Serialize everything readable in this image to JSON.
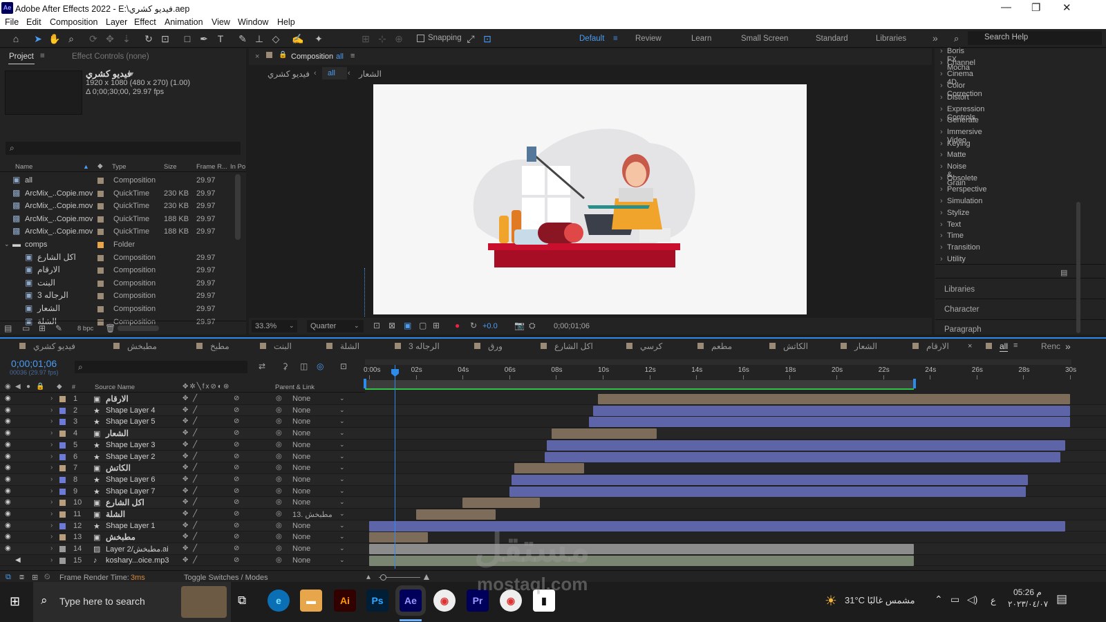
{
  "window": {
    "title": "Adobe After Effects 2022 - E:\\فيديو كشري.aep",
    "app_badge": "Ae"
  },
  "menu": [
    "File",
    "Edit",
    "Composition",
    "Layer",
    "Effect",
    "Animation",
    "View",
    "Window",
    "Help"
  ],
  "toolbar": {
    "snapping_label": "Snapping",
    "workspaces": [
      "Default",
      "Review",
      "Learn",
      "Small Screen",
      "Standard",
      "Libraries"
    ],
    "active_workspace": "Default",
    "search_placeholder": "Search Help"
  },
  "project": {
    "tab_project": "Project",
    "tab_effect_controls": "Effect Controls (none)",
    "comp_name": "فيديو كشري",
    "comp_dims": "1920 x 1080  (480 x 270) (1.00)",
    "comp_duration": "Δ 0;00;30;00, 29.97 fps",
    "columns": [
      "Name",
      "Type",
      "Size",
      "Frame R...",
      "In Po"
    ],
    "items": [
      {
        "name": "all",
        "type": "Composition",
        "size": "",
        "fps": "29.97",
        "color": "#9b8a76",
        "icon": "comp-icon"
      },
      {
        "name": "ArcMix_..Copie.mov",
        "type": "QuickTime",
        "size": "230 KB",
        "fps": "29.97",
        "color": "#9b8a76",
        "icon": "footage-icon"
      },
      {
        "name": "ArcMix_..Copie.mov",
        "type": "QuickTime",
        "size": "230 KB",
        "fps": "29.97",
        "color": "#9b8a76",
        "icon": "footage-icon"
      },
      {
        "name": "ArcMix_..Copie.mov",
        "type": "QuickTime",
        "size": "188 KB",
        "fps": "29.97",
        "color": "#9b8a76",
        "icon": "footage-icon"
      },
      {
        "name": "ArcMix_..Copie.mov",
        "type": "QuickTime",
        "size": "188 KB",
        "fps": "29.97",
        "color": "#9b8a76",
        "icon": "footage-icon"
      },
      {
        "name": "comps",
        "type": "Folder",
        "size": "",
        "fps": "",
        "color": "#e8a64a",
        "icon": "folder-icon"
      },
      {
        "name": "اكل الشارع",
        "type": "Composition",
        "size": "",
        "fps": "29.97",
        "color": "#9b8a76",
        "icon": "comp-icon"
      },
      {
        "name": "الارقام",
        "type": "Composition",
        "size": "",
        "fps": "29.97",
        "color": "#9b8a76",
        "icon": "comp-icon"
      },
      {
        "name": "البنت",
        "type": "Composition",
        "size": "",
        "fps": "29.97",
        "color": "#9b8a76",
        "icon": "comp-icon"
      },
      {
        "name": "الرجاله 3",
        "type": "Composition",
        "size": "",
        "fps": "29.97",
        "color": "#9b8a76",
        "icon": "comp-icon"
      },
      {
        "name": "الشعار",
        "type": "Composition",
        "size": "",
        "fps": "29.97",
        "color": "#9b8a76",
        "icon": "comp-icon"
      },
      {
        "name": "الشلة",
        "type": "Composition",
        "size": "",
        "fps": "29.97",
        "color": "#9b8a76",
        "icon": "comp-icon"
      }
    ],
    "bpc": "8 bpc"
  },
  "composition": {
    "tab_label": "Composition",
    "tab_comp": "all",
    "breadcrumb": [
      "فيديو كشري",
      "all",
      "الشعار"
    ],
    "zoom": "33.3%",
    "resolution": "Quarter",
    "exposure": "+0.0",
    "timecode": "0;00;01;06"
  },
  "effects": {
    "categories": [
      "Boris FX Mocha",
      "Channel",
      "Cinema 4D",
      "Color Correction",
      "Distort",
      "Expression Controls",
      "Generate",
      "Immersive Video",
      "Keying",
      "Matte",
      "Noise & Grain",
      "Obsolete",
      "Perspective",
      "Simulation",
      "Stylize",
      "Text",
      "Time",
      "Transition",
      "Utility"
    ],
    "panels": [
      "Libraries",
      "Character",
      "Paragraph"
    ]
  },
  "timeline": {
    "tabs": [
      "فيديو كشري",
      "مطبخش",
      "مطبخ",
      "البنت",
      "الشلة",
      "الرجاله 3",
      "ورق",
      "اكل الشارع",
      "كرسي",
      "مطعم",
      "الكاتش",
      "الشعار",
      "الارقام",
      "all",
      "Renc"
    ],
    "active_tab": "all",
    "timecode": "0;00;01;06",
    "frame_info": "00036 (29.97 fps)",
    "col_source": "Source Name",
    "col_parent": "Parent & Link",
    "ruler": [
      "0:00s",
      "02s",
      "04s",
      "06s",
      "08s",
      "10s",
      "12s",
      "14s",
      "16s",
      "18s",
      "20s",
      "22s",
      "24s",
      "26s",
      "28s",
      "30s"
    ],
    "work_area_end_s": 23.3,
    "playhead_s": 1.2,
    "footer_render": "Frame Render Time:",
    "footer_render_val": "3ms",
    "footer_toggle": "Toggle Switches / Modes",
    "layers": [
      {
        "n": "1",
        "name": "الارقام",
        "kind": "comp",
        "color": "#b89e7d",
        "parent": "None",
        "start": 9.8,
        "end": 30,
        "bar": "brown"
      },
      {
        "n": "2",
        "name": "Shape Layer 4",
        "kind": "shape",
        "color": "#6e7ad8",
        "parent": "None",
        "start": 9.6,
        "end": 30,
        "bar": "blue"
      },
      {
        "n": "3",
        "name": "Shape Layer 5",
        "kind": "shape",
        "color": "#6e7ad8",
        "parent": "None",
        "start": 9.4,
        "end": 30,
        "bar": "blue"
      },
      {
        "n": "4",
        "name": "الشعار",
        "kind": "comp",
        "color": "#b89e7d",
        "parent": "None",
        "start": 7.8,
        "end": 12.3,
        "bar": "brown"
      },
      {
        "n": "5",
        "name": "Shape Layer 3",
        "kind": "shape",
        "color": "#6e7ad8",
        "parent": "None",
        "start": 7.6,
        "end": 29.8,
        "bar": "blue"
      },
      {
        "n": "6",
        "name": "Shape Layer 2",
        "kind": "shape",
        "color": "#6e7ad8",
        "parent": "None",
        "start": 7.5,
        "end": 29.6,
        "bar": "blue"
      },
      {
        "n": "7",
        "name": "الكاتش",
        "kind": "comp",
        "color": "#b89e7d",
        "parent": "None",
        "start": 6.2,
        "end": 9.2,
        "bar": "brown"
      },
      {
        "n": "8",
        "name": "Shape Layer 6",
        "kind": "shape",
        "color": "#6e7ad8",
        "parent": "None",
        "start": 6.1,
        "end": 28.2,
        "bar": "blue"
      },
      {
        "n": "9",
        "name": "Shape Layer 7",
        "kind": "shape",
        "color": "#6e7ad8",
        "parent": "None",
        "start": 6.0,
        "end": 28.1,
        "bar": "blue"
      },
      {
        "n": "10",
        "name": "اكل الشارع",
        "kind": "comp",
        "color": "#b89e7d",
        "parent": "None",
        "start": 4.0,
        "end": 7.3,
        "bar": "brown"
      },
      {
        "n": "11",
        "name": "الشلة",
        "kind": "comp",
        "color": "#b89e7d",
        "parent": "13. مطبخش",
        "start": 2.0,
        "end": 5.4,
        "bar": "brown"
      },
      {
        "n": "12",
        "name": "Shape Layer 1",
        "kind": "shape",
        "color": "#6e7ad8",
        "parent": "None",
        "start": 0,
        "end": 29.8,
        "bar": "blue"
      },
      {
        "n": "13",
        "name": "مطبخش",
        "kind": "comp",
        "color": "#b89e7d",
        "parent": "None",
        "start": 0,
        "end": 2.5,
        "bar": "brown"
      },
      {
        "n": "14",
        "name": "Layer 2/مطبخش.ai",
        "kind": "ai",
        "color": "#9a9a9a",
        "parent": "None",
        "start": 0,
        "end": 23.3,
        "bar": "gray"
      },
      {
        "n": "15",
        "name": "koshary...oice.mp3",
        "kind": "audio",
        "color": "#9a9a9a",
        "parent": "None",
        "start": 0,
        "end": 23.3,
        "bar": "green"
      }
    ]
  },
  "taskbar": {
    "search_placeholder": "Type here to search",
    "weather": "31°C  مشمس غالبًا",
    "time": "05:26 م",
    "date": "٢٠٢٣/٠٤/٠٧",
    "lang": "ع",
    "apps": [
      {
        "label": "Ai",
        "bg": "#330000",
        "fg": "#ff9a00",
        "name": "illustrator-icon"
      },
      {
        "label": "Ps",
        "bg": "#001e36",
        "fg": "#31a8ff",
        "name": "photoshop-icon"
      },
      {
        "label": "Ae",
        "bg": "#00005b",
        "fg": "#9999ff",
        "name": "after-effects-icon"
      },
      {
        "label": "Pr",
        "bg": "#00005b",
        "fg": "#9999ff",
        "name": "premiere-icon"
      }
    ]
  },
  "watermark": {
    "text": "مستقل",
    "domain": "mostaql.com"
  }
}
